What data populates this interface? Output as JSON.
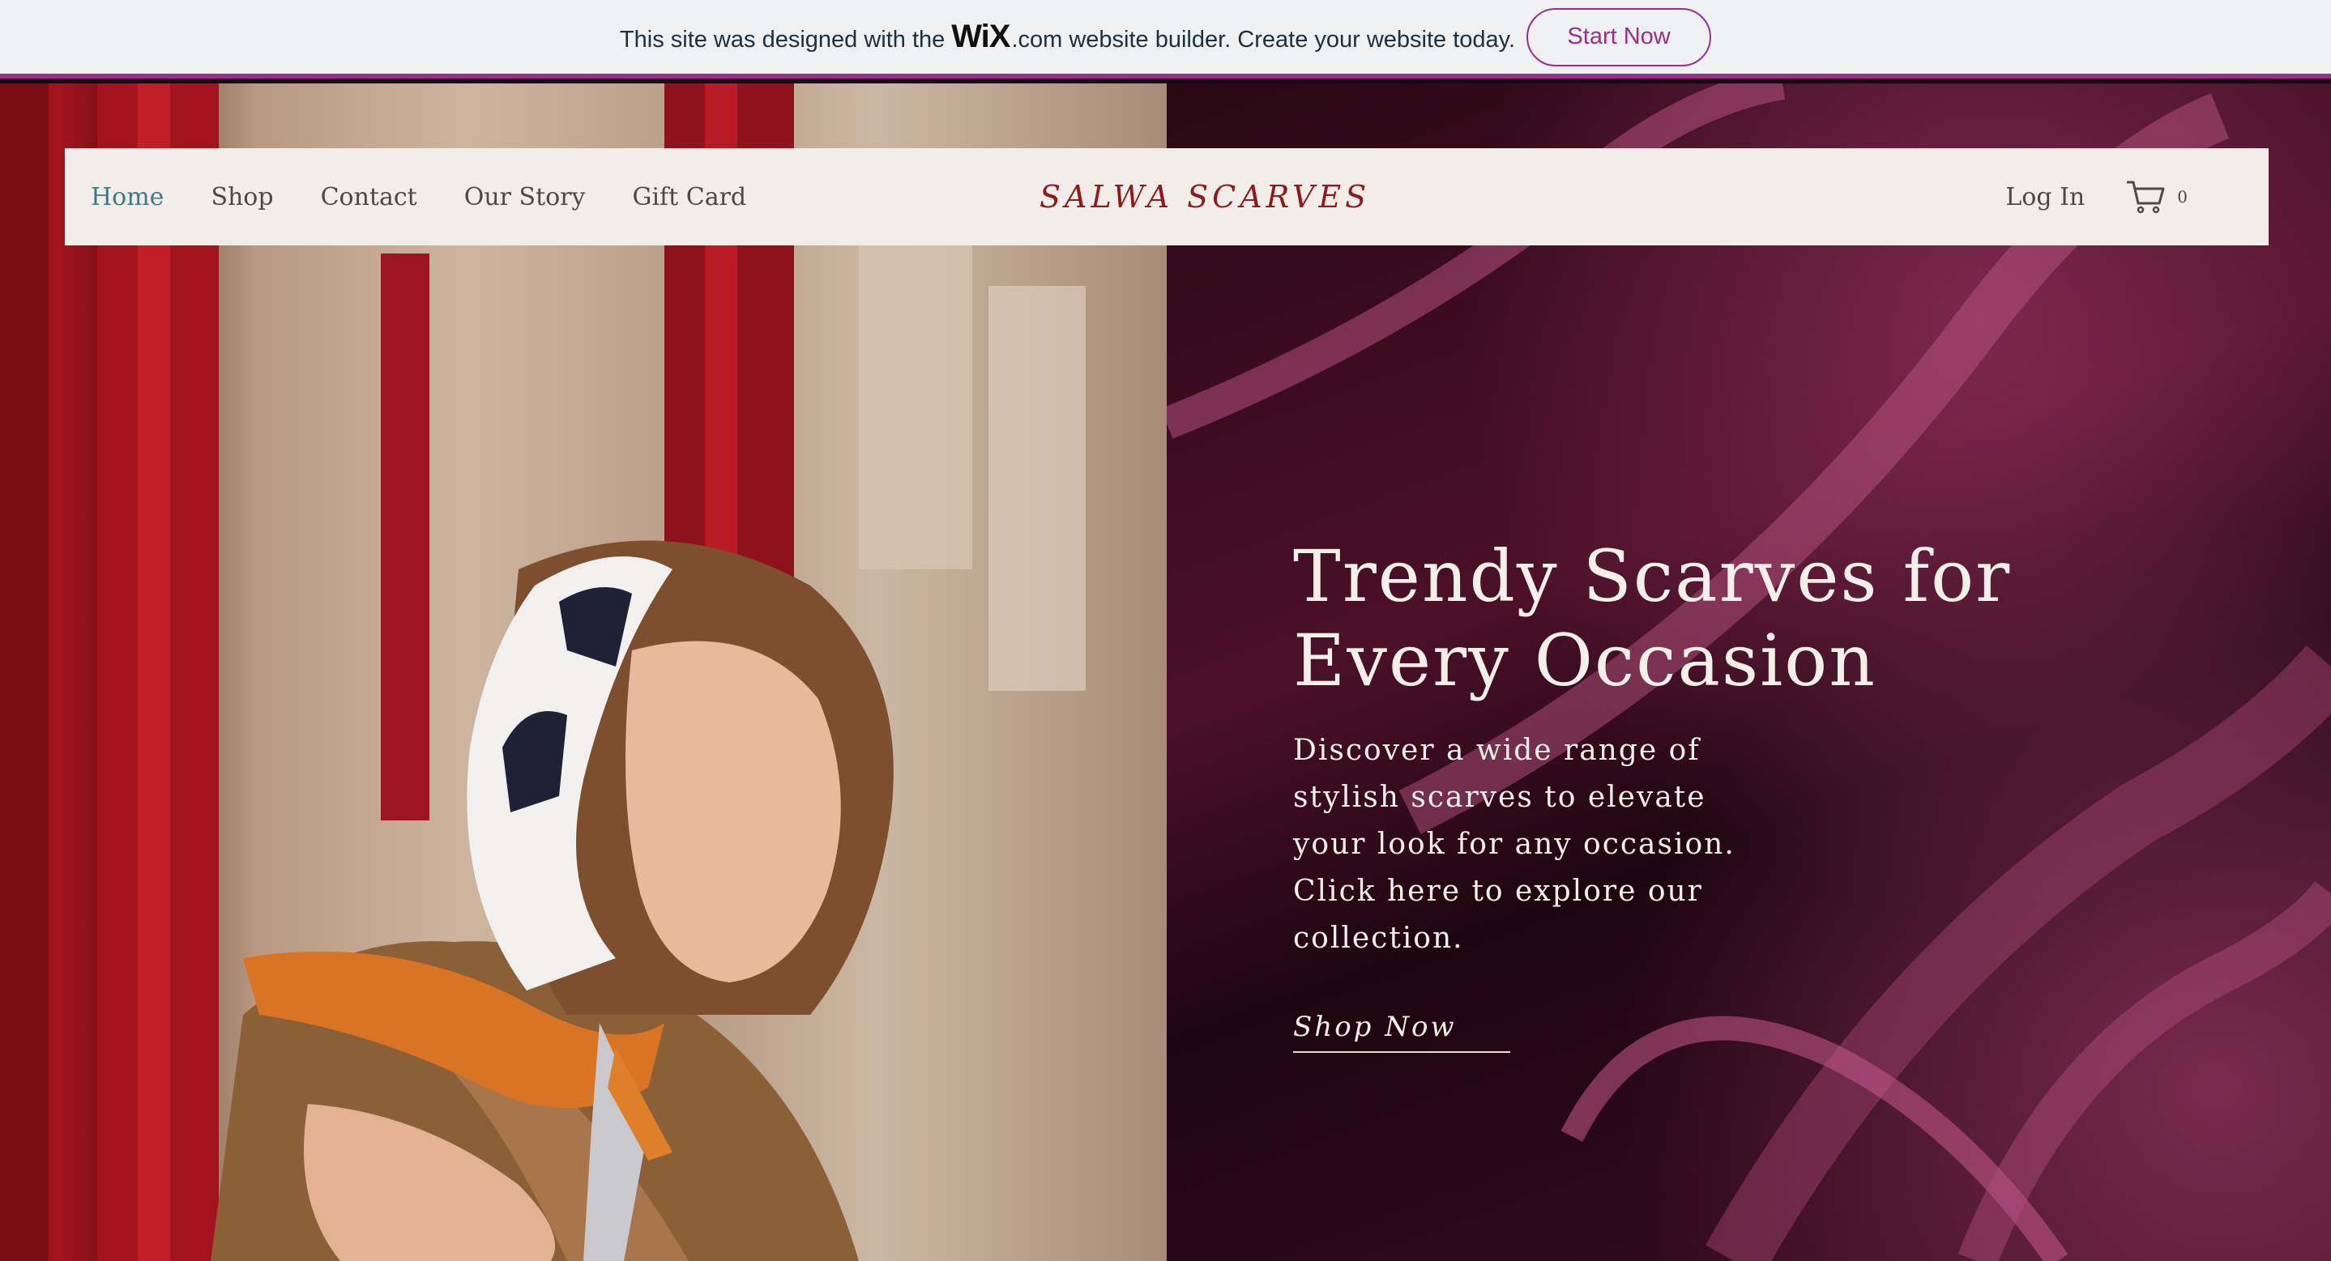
{
  "banner": {
    "text_before": "This site was designed with the",
    "wix_logo": "WiX",
    "wix_dotcom": ".com",
    "text_after": "website builder. Create your website today.",
    "start_button": "Start Now"
  },
  "nav": {
    "links": [
      "Home",
      "Shop",
      "Contact",
      "Our Story",
      "Gift Card"
    ],
    "active": "Home",
    "brand": "SALWA SCARVES",
    "login": "Log In",
    "cart_icon": "cart-icon",
    "cart_count": "0"
  },
  "hero": {
    "title": "Trendy Scarves for Every Occasion",
    "description": "Discover a wide range of stylish scarves to elevate your look for any occasion. Click here to explore our collection.",
    "cta": "Shop Now"
  },
  "colors": {
    "accent": "#9c2d8f",
    "brand": "#8d1a1f",
    "nav_active": "#3f7a82",
    "nav_bg": "#f2ede8"
  }
}
